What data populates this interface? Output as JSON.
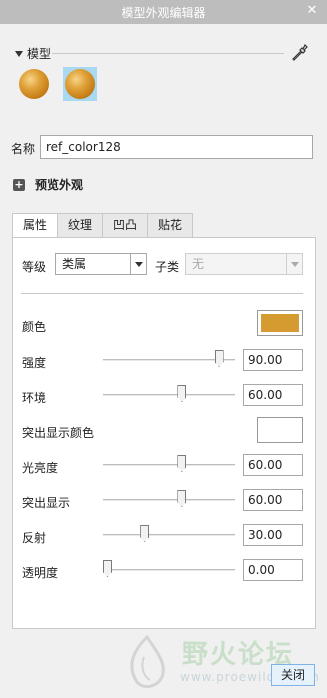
{
  "window": {
    "title": "模型外观编辑器"
  },
  "model_section": {
    "label": "模型"
  },
  "name": {
    "label": "名称",
    "value": "ref_color128"
  },
  "preview": {
    "label": "预览外观"
  },
  "tabs": [
    {
      "label": "属性",
      "active": true
    },
    {
      "label": "纹理",
      "active": false
    },
    {
      "label": "凹凸",
      "active": false
    },
    {
      "label": "贴花",
      "active": false
    }
  ],
  "properties": {
    "class_label": "等级",
    "class_value": "类属",
    "subclass_label": "子类",
    "subclass_value": "无",
    "color_label": "颜色",
    "color_value": "#d59a30",
    "sliders": [
      {
        "label": "强度",
        "value": "90.00",
        "level": 0.9
      },
      {
        "label": "环境",
        "value": "60.00",
        "level": 0.6
      },
      {
        "label": "突出显示颜色",
        "color": "#ffffff"
      },
      {
        "label": "光亮度",
        "value": "60.00",
        "level": 0.6
      },
      {
        "label": "突出显示",
        "value": "60.00",
        "level": 0.6
      },
      {
        "label": "反射",
        "value": "30.00",
        "level": 0.3
      },
      {
        "label": "透明度",
        "value": "0.00",
        "level": 0.0
      }
    ]
  },
  "watermark": {
    "text": "野火论坛",
    "url": "www.proewildfire.cn"
  },
  "footer": {
    "close_label": "关闭"
  },
  "icons": {
    "close": "close-icon",
    "eyedropper": "eyedropper-icon",
    "expand": "plus-icon",
    "collapse": "triangle-down-icon"
  }
}
